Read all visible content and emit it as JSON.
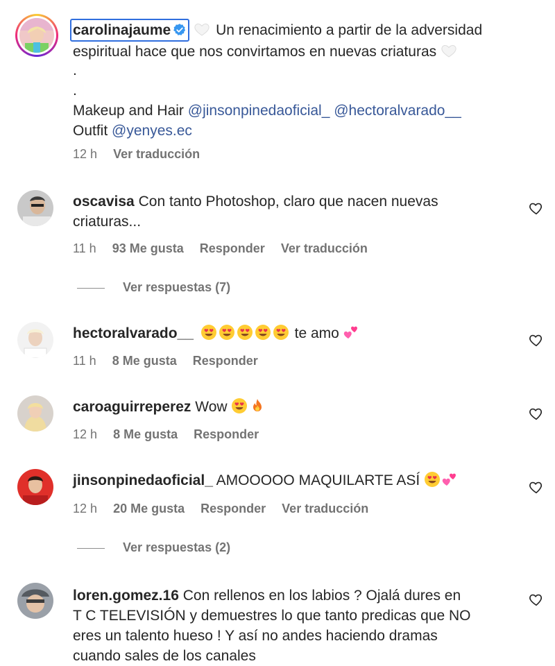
{
  "caption": {
    "username": "carolinajaume",
    "text": "Un renacimiento a partir de la adversidad espiritual hace que nos convirtamos en nuevas criaturas",
    "dot1": ".",
    "dot2": ".",
    "makeup_label": "Makeup and Hair",
    "mention1": "@jinsonpinedaoficial_",
    "mention2": "@hectoralvarado__",
    "outfit_label": "Outfit",
    "mention3": "@yenyes.ec",
    "time": "12 h",
    "translate": "Ver traducción"
  },
  "comments": [
    {
      "username": "oscavisa",
      "text_line1": "Con tanto Photoshop, claro que nacen nuevas",
      "text_line2": "criaturas...",
      "time": "11 h",
      "likes": "93 Me gusta",
      "reply": "Responder",
      "translate": "Ver traducción",
      "view_replies": "Ver respuestas (7)"
    },
    {
      "username": "hectoralvarado__",
      "text": "te amo",
      "time": "11 h",
      "likes": "8 Me gusta",
      "reply": "Responder"
    },
    {
      "username": "caroaguirreperez",
      "text": "Wow",
      "time": "12 h",
      "likes": "8 Me gusta",
      "reply": "Responder"
    },
    {
      "username": "jinsonpinedaoficial_",
      "text": "AMOOOOO MAQUILARTE ASÍ",
      "time": "12 h",
      "likes": "20 Me gusta",
      "reply": "Responder",
      "translate": "Ver traducción",
      "view_replies": "Ver respuestas (2)"
    },
    {
      "username": "loren.gomez.16",
      "text_line1": "Con rellenos en los labios ? Ojalá dures en",
      "text_line2": "T C TELEVISIÓN y demuestres lo que tanto predicas que NO",
      "text_line3": "eres un talento hueso ! Y así no andes haciendo dramas",
      "text_line4": "cuando sales de los canales"
    }
  ],
  "icons": {
    "like": "heart-outline-icon",
    "verified": "verified-badge-icon",
    "white_heart": "white-heart-emoji",
    "heart_eyes": "heart-eyes-emoji",
    "fire": "fire-emoji",
    "two_hearts": "two-hearts-emoji"
  },
  "colors": {
    "text": "#262626",
    "secondary": "#737373",
    "mention": "#385898",
    "verified": "#3897f0",
    "focus_outline": "#2f6ede"
  }
}
